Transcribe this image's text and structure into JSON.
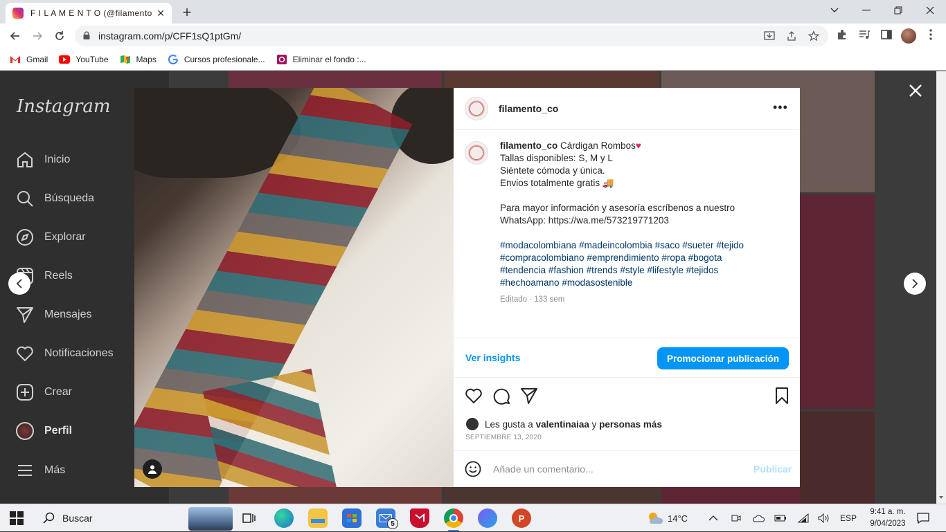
{
  "browser": {
    "tab_title": "F I L A M E N T O (@filamento_co",
    "tab_close": "✕",
    "new_tab": "+",
    "url": "instagram.com/p/CFF1sQ1ptGm/",
    "bookmarks": [
      "Gmail",
      "YouTube",
      "Maps",
      "Cursos profesionale...",
      "Eliminar el fondo :..."
    ]
  },
  "sidebar": {
    "logo": "Instagram",
    "items": [
      {
        "label": "Inicio",
        "icon": "home-icon"
      },
      {
        "label": "Búsqueda",
        "icon": "search-icon"
      },
      {
        "label": "Explorar",
        "icon": "compass-icon"
      },
      {
        "label": "Reels",
        "icon": "reels-icon"
      },
      {
        "label": "Mensajes",
        "icon": "send-icon"
      },
      {
        "label": "Notificaciones",
        "icon": "heart-icon"
      },
      {
        "label": "Crear",
        "icon": "plus-square-icon"
      },
      {
        "label": "Perfil",
        "icon": "profile-avatar"
      },
      {
        "label": "Más",
        "icon": "menu-icon"
      }
    ]
  },
  "post": {
    "username": "filamento_co",
    "more": "•••",
    "caption": {
      "username": "filamento_co",
      "title": " Cárdigan Rombos",
      "title_emoji": "♥",
      "lines": [
        "Tallas disponibles: S, M y L",
        "Siéntete cómoda y única.",
        "Envios totalmente gratis 🚚",
        "",
        "Para mayor información y asesoría escríbenos a nuestro",
        "WhatsApp: https://wa.me/573219771203",
        ""
      ],
      "hashtag_lines": [
        "#modacolombiana #madeincolombia #saco #sueter #tejido",
        "#compracolombiano #emprendimiento #ropa #bogota",
        "#tendencia #fashion #trends #style #lifestyle #tejidos",
        "#hechoamano #modasostenible"
      ],
      "meta": "Editado · 133 sem"
    },
    "insights_label": "Ver insights",
    "promote_label": "Promocionar publicación",
    "likes": {
      "prefix": "Les gusta a ",
      "user": "valentinaiaa",
      "middle": " y ",
      "others": "personas más"
    },
    "date": "SEPTIEMBRE 13, 2020",
    "comment_placeholder": "Añade un comentario...",
    "publish_label": "Publicar"
  },
  "taskbar": {
    "search": "Buscar",
    "mail_badge": "5",
    "weather": "14°C",
    "language": "ESP",
    "time": "9:41 a. m.",
    "date": "9/04/2023"
  },
  "colors": {
    "accent": "#0095f6",
    "link": "#00376b",
    "heart": "#e0245e"
  }
}
